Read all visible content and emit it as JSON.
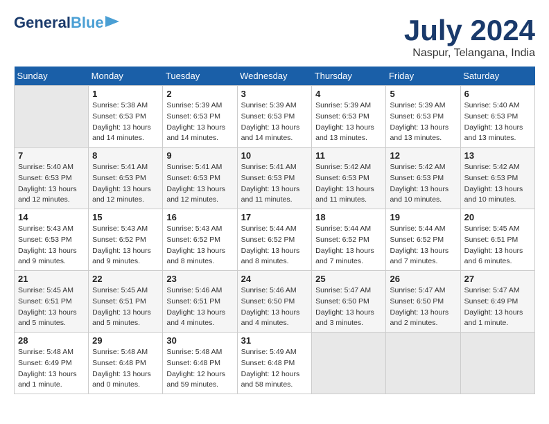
{
  "logo": {
    "text1": "General",
    "text2": "Blue"
  },
  "header": {
    "month": "July 2024",
    "location": "Naspur, Telangana, India"
  },
  "columns": [
    "Sunday",
    "Monday",
    "Tuesday",
    "Wednesday",
    "Thursday",
    "Friday",
    "Saturday"
  ],
  "weeks": [
    [
      {
        "day": "",
        "info": ""
      },
      {
        "day": "1",
        "info": "Sunrise: 5:38 AM\nSunset: 6:53 PM\nDaylight: 13 hours\nand 14 minutes."
      },
      {
        "day": "2",
        "info": "Sunrise: 5:39 AM\nSunset: 6:53 PM\nDaylight: 13 hours\nand 14 minutes."
      },
      {
        "day": "3",
        "info": "Sunrise: 5:39 AM\nSunset: 6:53 PM\nDaylight: 13 hours\nand 14 minutes."
      },
      {
        "day": "4",
        "info": "Sunrise: 5:39 AM\nSunset: 6:53 PM\nDaylight: 13 hours\nand 13 minutes."
      },
      {
        "day": "5",
        "info": "Sunrise: 5:39 AM\nSunset: 6:53 PM\nDaylight: 13 hours\nand 13 minutes."
      },
      {
        "day": "6",
        "info": "Sunrise: 5:40 AM\nSunset: 6:53 PM\nDaylight: 13 hours\nand 13 minutes."
      }
    ],
    [
      {
        "day": "7",
        "info": "Sunrise: 5:40 AM\nSunset: 6:53 PM\nDaylight: 13 hours\nand 12 minutes."
      },
      {
        "day": "8",
        "info": "Sunrise: 5:41 AM\nSunset: 6:53 PM\nDaylight: 13 hours\nand 12 minutes."
      },
      {
        "day": "9",
        "info": "Sunrise: 5:41 AM\nSunset: 6:53 PM\nDaylight: 13 hours\nand 12 minutes."
      },
      {
        "day": "10",
        "info": "Sunrise: 5:41 AM\nSunset: 6:53 PM\nDaylight: 13 hours\nand 11 minutes."
      },
      {
        "day": "11",
        "info": "Sunrise: 5:42 AM\nSunset: 6:53 PM\nDaylight: 13 hours\nand 11 minutes."
      },
      {
        "day": "12",
        "info": "Sunrise: 5:42 AM\nSunset: 6:53 PM\nDaylight: 13 hours\nand 10 minutes."
      },
      {
        "day": "13",
        "info": "Sunrise: 5:42 AM\nSunset: 6:53 PM\nDaylight: 13 hours\nand 10 minutes."
      }
    ],
    [
      {
        "day": "14",
        "info": "Sunrise: 5:43 AM\nSunset: 6:53 PM\nDaylight: 13 hours\nand 9 minutes."
      },
      {
        "day": "15",
        "info": "Sunrise: 5:43 AM\nSunset: 6:52 PM\nDaylight: 13 hours\nand 9 minutes."
      },
      {
        "day": "16",
        "info": "Sunrise: 5:43 AM\nSunset: 6:52 PM\nDaylight: 13 hours\nand 8 minutes."
      },
      {
        "day": "17",
        "info": "Sunrise: 5:44 AM\nSunset: 6:52 PM\nDaylight: 13 hours\nand 8 minutes."
      },
      {
        "day": "18",
        "info": "Sunrise: 5:44 AM\nSunset: 6:52 PM\nDaylight: 13 hours\nand 7 minutes."
      },
      {
        "day": "19",
        "info": "Sunrise: 5:44 AM\nSunset: 6:52 PM\nDaylight: 13 hours\nand 7 minutes."
      },
      {
        "day": "20",
        "info": "Sunrise: 5:45 AM\nSunset: 6:51 PM\nDaylight: 13 hours\nand 6 minutes."
      }
    ],
    [
      {
        "day": "21",
        "info": "Sunrise: 5:45 AM\nSunset: 6:51 PM\nDaylight: 13 hours\nand 5 minutes."
      },
      {
        "day": "22",
        "info": "Sunrise: 5:45 AM\nSunset: 6:51 PM\nDaylight: 13 hours\nand 5 minutes."
      },
      {
        "day": "23",
        "info": "Sunrise: 5:46 AM\nSunset: 6:51 PM\nDaylight: 13 hours\nand 4 minutes."
      },
      {
        "day": "24",
        "info": "Sunrise: 5:46 AM\nSunset: 6:50 PM\nDaylight: 13 hours\nand 4 minutes."
      },
      {
        "day": "25",
        "info": "Sunrise: 5:47 AM\nSunset: 6:50 PM\nDaylight: 13 hours\nand 3 minutes."
      },
      {
        "day": "26",
        "info": "Sunrise: 5:47 AM\nSunset: 6:50 PM\nDaylight: 13 hours\nand 2 minutes."
      },
      {
        "day": "27",
        "info": "Sunrise: 5:47 AM\nSunset: 6:49 PM\nDaylight: 13 hours\nand 1 minute."
      }
    ],
    [
      {
        "day": "28",
        "info": "Sunrise: 5:48 AM\nSunset: 6:49 PM\nDaylight: 13 hours\nand 1 minute."
      },
      {
        "day": "29",
        "info": "Sunrise: 5:48 AM\nSunset: 6:48 PM\nDaylight: 13 hours\nand 0 minutes."
      },
      {
        "day": "30",
        "info": "Sunrise: 5:48 AM\nSunset: 6:48 PM\nDaylight: 12 hours\nand 59 minutes."
      },
      {
        "day": "31",
        "info": "Sunrise: 5:49 AM\nSunset: 6:48 PM\nDaylight: 12 hours\nand 58 minutes."
      },
      {
        "day": "",
        "info": ""
      },
      {
        "day": "",
        "info": ""
      },
      {
        "day": "",
        "info": ""
      }
    ]
  ]
}
